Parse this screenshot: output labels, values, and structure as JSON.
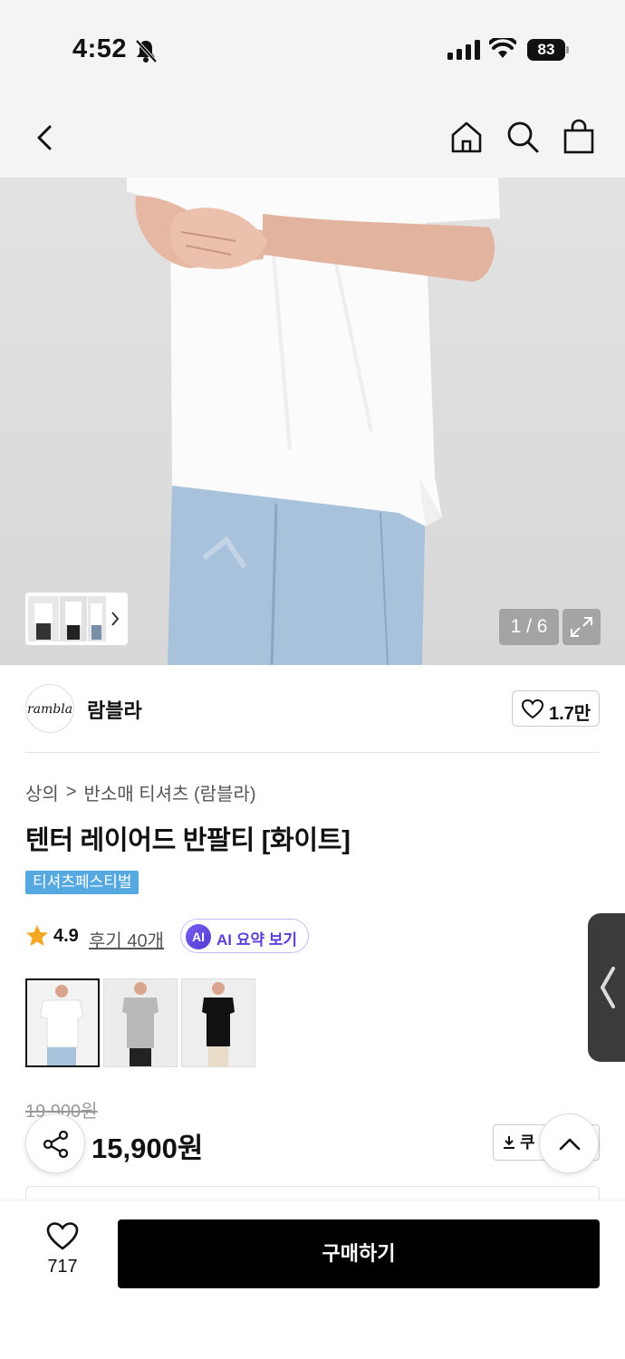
{
  "status": {
    "time": "4:52",
    "battery": "83"
  },
  "nav": {
    "back": "back",
    "home": "home",
    "search": "search",
    "bag": "bag"
  },
  "gallery": {
    "counter": "1 / 6"
  },
  "brand": {
    "logo_text": "rambla",
    "name": "람블라",
    "likes": "1.7만"
  },
  "breadcrumb": {
    "category": "상의",
    "separator": ">",
    "subcategory": "반소매 티셔츠 (람블라)"
  },
  "product": {
    "title": "텐터 레이어드 반팔티 [화이트]",
    "promo_tag": "티셔츠페스티벌",
    "rating": "4.9",
    "reviews": "후기 40개",
    "ai_badge": "AI",
    "ai_label": "AI 요약 보기",
    "variants": [
      "white",
      "gray",
      "black"
    ],
    "original_price": "19,900원",
    "price": "15,900원",
    "coupon": "쿠"
  },
  "bottom": {
    "wish_count": "717",
    "buy_label": "구매하기"
  },
  "colors": {
    "promo": "#56a9e0",
    "ai_accent": "#5b3fd8",
    "buy_bg": "#000000"
  }
}
